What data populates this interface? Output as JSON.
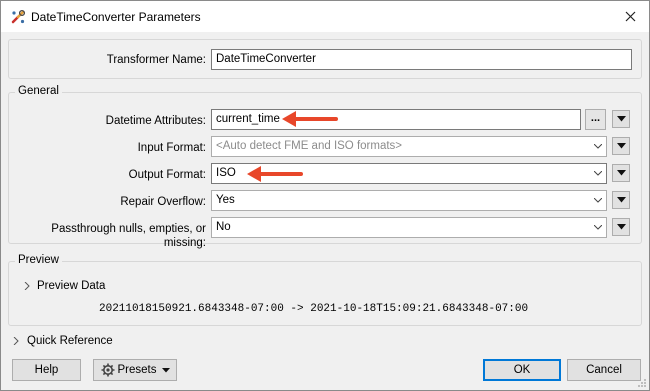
{
  "window": {
    "title": "DateTimeConverter Parameters"
  },
  "transformer_name": {
    "label": "Transformer Name:",
    "value": "DateTimeConverter"
  },
  "general": {
    "title": "General",
    "datetime_attributes": {
      "label": "Datetime Attributes:",
      "value": "current_time",
      "dots": "..."
    },
    "input_format": {
      "label": "Input Format:",
      "placeholder": "<Auto detect FME and ISO formats>"
    },
    "output_format": {
      "label": "Output Format:",
      "value": "ISO"
    },
    "repair_overflow": {
      "label": "Repair Overflow:",
      "value": "Yes"
    },
    "passthrough": {
      "label": "Passthrough nulls, empties, or missing:",
      "value": "No"
    }
  },
  "preview": {
    "title": "Preview",
    "data_label": "Preview Data",
    "data_text": "20211018150921.6843348-07:00 -> 2021-10-18T15:09:21.6843348-07:00"
  },
  "quick_reference": {
    "label": "Quick Reference"
  },
  "buttons": {
    "help": "Help",
    "presets": "Presets",
    "ok": "OK",
    "cancel": "Cancel"
  },
  "colors": {
    "annotation_arrow": "#e8472a",
    "default_button_border": "#0078d7"
  },
  "icons": {
    "app": "fme-transformer-icon",
    "close": "close-icon",
    "presets": "gear-icon",
    "dropdown": "chevron-down-icon",
    "expand": "chevron-right-icon"
  }
}
